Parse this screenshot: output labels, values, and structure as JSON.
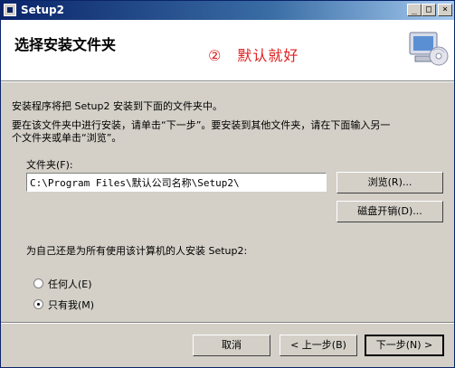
{
  "window": {
    "title": "Setup2"
  },
  "titlebar_buttons": {
    "minimize": "_",
    "maximize": "□",
    "close": "×"
  },
  "header": {
    "title": "选择安装文件夹",
    "annotation": "②　默认就好",
    "icon": "computer-cd-icon"
  },
  "body": {
    "line1": "安装程序将把 Setup2 安装到下面的文件夹中。",
    "line2": "要在该文件夹中进行安装，请单击“下一步”。要安装到其他文件夹，请在下面输入另一",
    "line3": "个文件夹或单击“浏览”。"
  },
  "folder": {
    "label": "文件夹(F):",
    "value": "C:\\Program Files\\默认公司名称\\Setup2\\"
  },
  "buttons": {
    "browse": "浏览(R)...",
    "disk_cost": "磁盘开销(D)...",
    "cancel": "取消",
    "back": "< 上一步(B)",
    "next": "下一步(N) >"
  },
  "install_for": {
    "prompt": "为自己还是为所有使用该计算机的人安装 Setup2:",
    "options": [
      {
        "label": "任何人(E)",
        "checked": false
      },
      {
        "label": "只有我(M)",
        "checked": true
      }
    ]
  }
}
